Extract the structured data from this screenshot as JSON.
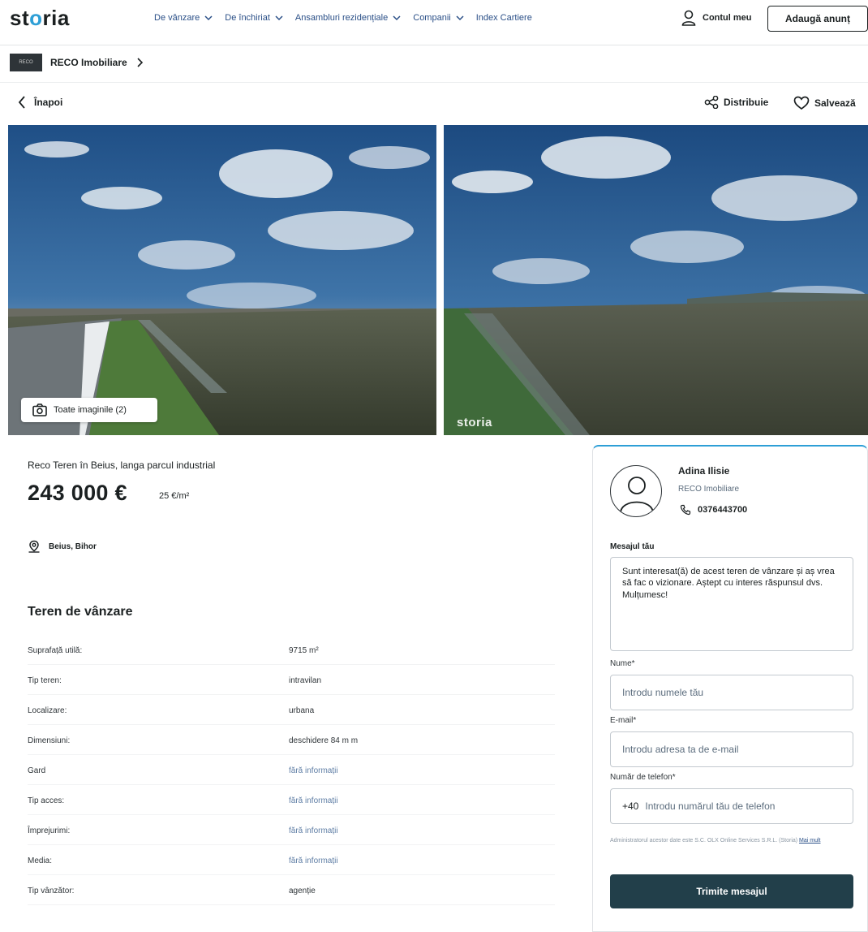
{
  "header": {
    "logo_pre": "st",
    "logo_accent": "o",
    "logo_post": "ria",
    "nav": [
      {
        "label": "De vânzare"
      },
      {
        "label": "De închiriat"
      },
      {
        "label": "Ansambluri rezidențiale"
      },
      {
        "label": "Companii"
      },
      {
        "label": "Index Cartiere"
      }
    ],
    "account_label": "Contul meu",
    "add_listing_label": "Adaugă anunț"
  },
  "agency_strip": {
    "logo_text": "RECO",
    "name": "RECO Imobiliare"
  },
  "actions": {
    "back_label": "Înapoi",
    "share_label": "Distribuie",
    "save_label": "Salvează"
  },
  "gallery": {
    "all_images_label": "Toate imaginile (2)",
    "watermark": "storia"
  },
  "listing": {
    "title": "Reco Teren în Beius, langa parcul industrial",
    "price": "243 000 €",
    "price_per_sqm": "25 €/m²",
    "location": "Beius, Bihor",
    "section_title": "Teren de vânzare",
    "specs": [
      {
        "key": "Suprafață utilă:",
        "value": "9715 m²",
        "muted": false
      },
      {
        "key": "Tip teren:",
        "value": "intravilan",
        "muted": false
      },
      {
        "key": "Localizare:",
        "value": "urbana",
        "muted": false
      },
      {
        "key": "Dimensiuni:",
        "value": "deschidere 84 m m",
        "muted": false
      },
      {
        "key": "Gard",
        "value": "fără informații",
        "muted": true
      },
      {
        "key": "Tip acces:",
        "value": "fără informații",
        "muted": true
      },
      {
        "key": "Împrejurimi:",
        "value": "fără informații",
        "muted": true
      },
      {
        "key": "Media:",
        "value": "fără informații",
        "muted": true
      },
      {
        "key": "Tip vânzător:",
        "value": "agenție",
        "muted": false
      }
    ]
  },
  "contact": {
    "agent_name": "Adina Ilisie",
    "agent_agency": "RECO Imobiliare",
    "agent_phone": "0376443700",
    "message_label": "Mesajul tău",
    "message_value": "Sunt interesat(ă) de acest teren de vânzare și aș vrea să fac o vizionare. Aștept cu interes răspunsul dvs. Mulțumesc!",
    "name_label": "Nume*",
    "name_placeholder": "Introdu numele tău",
    "email_label": "E-mail*",
    "email_placeholder": "Introdu adresa ta de e-mail",
    "phone_label": "Număr de telefon*",
    "phone_prefix": "+40",
    "phone_placeholder": "Introdu numărul tău de telefon",
    "legal_text": "Administratorul acestor date este S.C. OLX Online Services S.R.L. (Storia)",
    "legal_link": "Mai mult",
    "submit_label": "Trimite mesajul"
  },
  "colors": {
    "brand_accent": "#2e9fd6",
    "nav_link": "#2a4f87",
    "submit_button": "#223f4a"
  }
}
